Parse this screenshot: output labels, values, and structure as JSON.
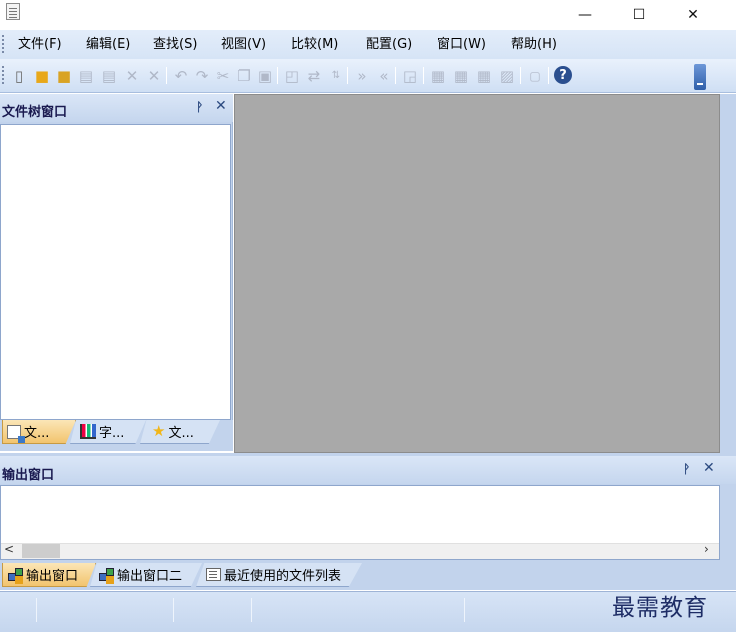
{
  "window": {
    "minimize_glyph": "—",
    "maximize_glyph": "☐",
    "close_glyph": "✕"
  },
  "menu": {
    "items": [
      "文件(F)",
      "编辑(E)",
      "查找(S)",
      "视图(V)",
      "比较(M)",
      "配置(G)",
      "窗口(W)",
      "帮助(H)"
    ]
  },
  "toolbar": {
    "icons": [
      "new-file-icon",
      "open-folder-icon",
      "open-recent-icon",
      "save-icon",
      "save-all-icon",
      "close-icon",
      "close-all-icon",
      "undo-icon",
      "redo-icon",
      "cut-icon",
      "copy-icon",
      "paste-icon",
      "find-icon",
      "replace-icon",
      "sort-icon",
      "next-difference-icon",
      "previous-difference-icon",
      "compare-icon",
      "merge-icon",
      "merge-all-icon",
      "merge-left-icon",
      "merge-right-icon",
      "goto-line-icon",
      "help-icon"
    ],
    "help_glyph": "?"
  },
  "file_tree_panel": {
    "title": "文件树窗口",
    "pin_glyph": "ᚹ",
    "close_glyph": "✕",
    "tabs": [
      "文...",
      "字...",
      "文..."
    ]
  },
  "output_panel": {
    "title": "输出窗口",
    "pin_glyph": "ᚹ",
    "close_glyph": "✕",
    "scroll_left_glyph": "<",
    "scroll_right_glyph": "›",
    "tabs": [
      "输出窗口",
      "输出窗口二",
      "最近使用的文件列表"
    ]
  },
  "watermark": "最需教育",
  "colors": {
    "chrome_blue": "#c2d3ec",
    "active_tab": "#f2c46e",
    "editor_area": "#a9a9a9"
  }
}
